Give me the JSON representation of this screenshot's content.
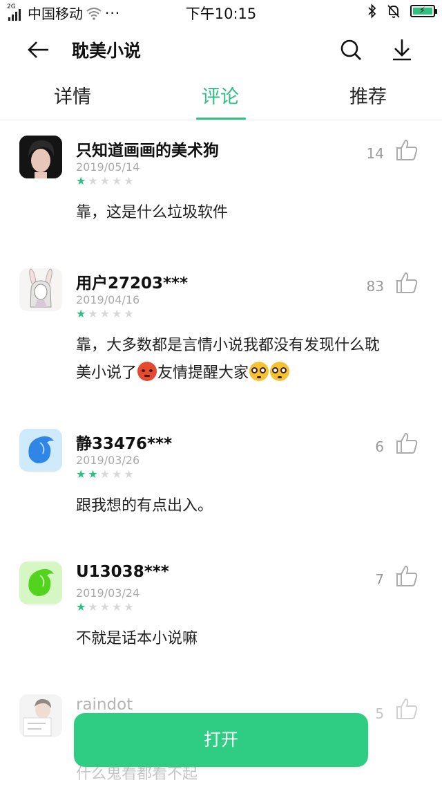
{
  "status_bar": {
    "gen": "2G",
    "carrier": "中国移动",
    "dots": "···",
    "time": "下午10:15"
  },
  "header": {
    "title": "耽美小说"
  },
  "tabs": [
    {
      "label": "详情",
      "active": false
    },
    {
      "label": "评论",
      "active": true
    },
    {
      "label": "推荐",
      "active": false
    }
  ],
  "reviews": [
    {
      "username": "只知道画画的美术狗",
      "date": "2019/05/14",
      "rating": 1,
      "likes": "14",
      "content": "靠，这是什么垃圾软件",
      "avatar": "portrait-dark"
    },
    {
      "username": "用户27203***",
      "date": "2019/04/16",
      "rating": 1,
      "likes": "83",
      "content_line1": "靠，大多数都是言情小说我都没有发现什么耽",
      "content_line2a": "美小说了",
      "content_line2b": "友情提醒大家",
      "emoji_1": "angry-face",
      "emoji_2": "flushed-face",
      "avatar": "bunny-ears-sketch"
    },
    {
      "username": "静33476***",
      "date": "2019/03/26",
      "rating": 2,
      "likes": "6",
      "content": "跟我想的有点出入。",
      "avatar": "blue-wolf"
    },
    {
      "username": "U13038***",
      "date": "2019/03/24",
      "rating": 1,
      "likes": "7",
      "content": "不就是话本小说嘛",
      "avatar": "green-wolf"
    },
    {
      "username": "raindot",
      "likes": "5",
      "content": "什么鬼看都看不起",
      "avatar": "boy-with-sign"
    }
  ],
  "open_button": {
    "label": "打开"
  },
  "colors": {
    "accent": "#2dbf83",
    "button": "#2fcd84",
    "star_off": "#d8d8d8",
    "muted": "#999999"
  }
}
